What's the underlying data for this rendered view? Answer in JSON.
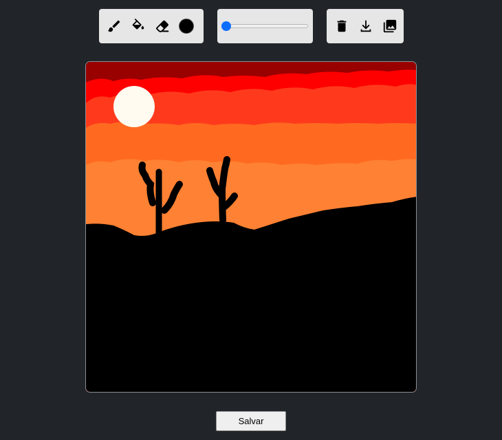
{
  "toolbar": {
    "tools": [
      {
        "name": "brush",
        "icon": "brush-icon"
      },
      {
        "name": "fill",
        "icon": "paint-bucket-icon"
      },
      {
        "name": "eraser",
        "icon": "eraser-icon"
      }
    ],
    "current_color": "#000000",
    "brush_size_slider": {
      "min": 1,
      "max": 100,
      "value": 1,
      "accent": "#0d6efd"
    },
    "actions": [
      {
        "name": "clear",
        "icon": "trash-icon"
      },
      {
        "name": "download",
        "icon": "download-icon"
      },
      {
        "name": "gallery",
        "icon": "image-gallery-icon"
      }
    ]
  },
  "canvas": {
    "description_colors": {
      "sky_top": "#990000",
      "sky_red": "#ff0000",
      "sky_orange_red": "#ff3a1c",
      "sky_orange": "#ff6a20",
      "sky_light_orange": "#ff8133",
      "sun": "#fffbf0",
      "ground": "#000000"
    }
  },
  "footer": {
    "save_label": "Salvar"
  }
}
